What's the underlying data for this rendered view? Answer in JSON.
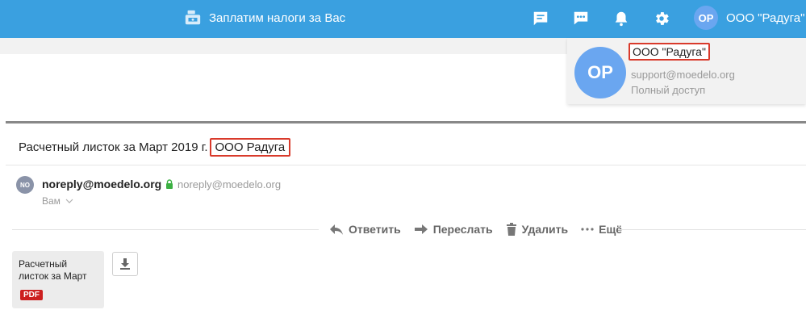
{
  "header": {
    "brand_text": "Заплатим налоги за Вас",
    "brand_icon": "cash-register-icon",
    "icons": [
      "feedback-icon",
      "chat-icon",
      "bell-icon",
      "gear-icon"
    ],
    "account_initials": "OP",
    "account_name": "ООО \"Радуга\""
  },
  "dropdown": {
    "initials": "OP",
    "company": "ООО \"Радуга\"",
    "email": "support@moedelo.org",
    "access": "Полный доступ"
  },
  "message": {
    "subject_prefix": "Расчетный листок за Март 2019 г.",
    "subject_company": "ООО Радуга",
    "sender_initials": "NO",
    "sender_name": "noreply@moedelo.org",
    "sender_address": "noreply@moedelo.org",
    "recipient": "Вам"
  },
  "actions": {
    "reply": "Ответить",
    "forward": "Переслать",
    "delete": "Удалить",
    "more": "Ещё"
  },
  "attachment": {
    "title": "Расчетный листок за Март",
    "type": "PDF"
  },
  "colors": {
    "topbar": "#3aa0e0",
    "avatar": "#6aa6f0",
    "highlight": "#d93a2b",
    "pdf": "#cc1f1f"
  }
}
